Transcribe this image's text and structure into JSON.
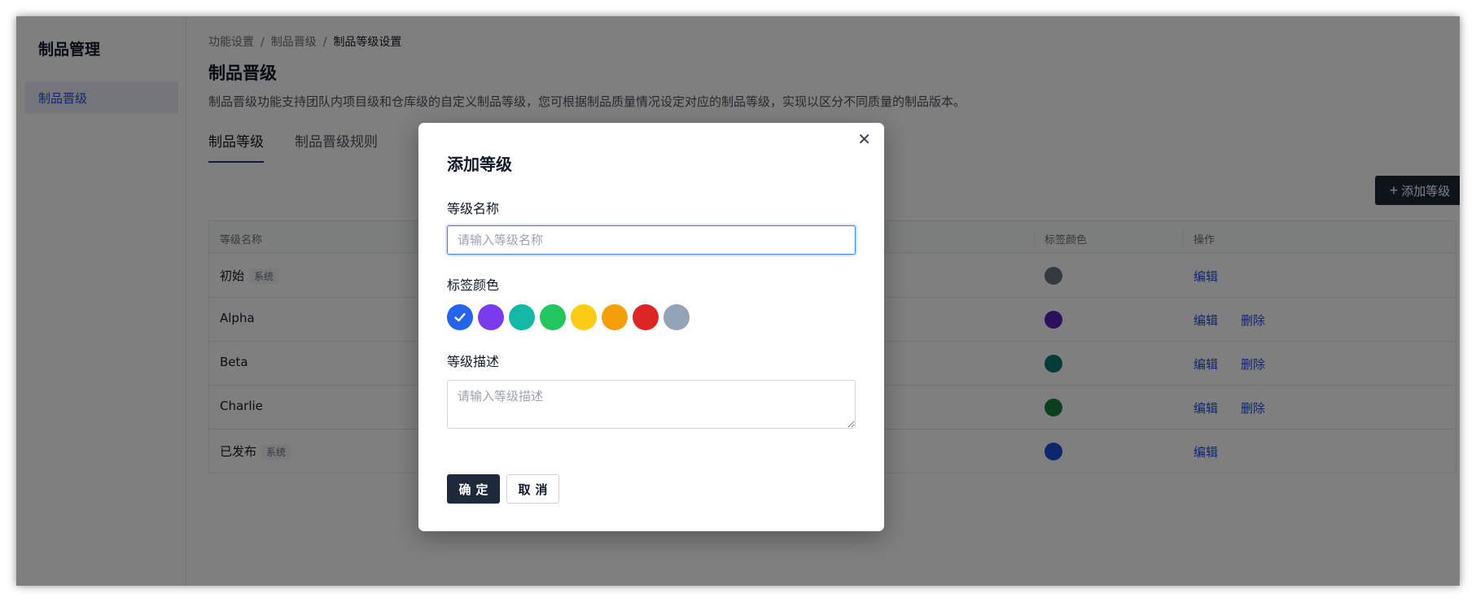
{
  "sidebar": {
    "title": "制品管理",
    "items": [
      {
        "label": "制品晋级"
      }
    ]
  },
  "breadcrumb": [
    "功能设置",
    "制品晋级",
    "制品等级设置"
  ],
  "page": {
    "title": "制品晋级",
    "description": "制品晋级功能支持团队内项目级和仓库级的自定义制品等级，您可根据制品质量情况设定对应的制品等级，实现以区分不同质量的制品版本。"
  },
  "tabs": [
    {
      "label": "制品等级",
      "active": true
    },
    {
      "label": "制品晋级规则",
      "active": false
    }
  ],
  "toolbar": {
    "add_button_label": "添加等级",
    "add_button_icon": "plus-icon"
  },
  "table": {
    "columns": [
      "等级名称",
      "标签颜色",
      "操作"
    ],
    "rows": [
      {
        "name": "初始",
        "badge": "系统",
        "color": "#6b7280",
        "actions": [
          "编辑"
        ]
      },
      {
        "name": "Alpha",
        "badge": "",
        "color": "#5b21b6",
        "actions": [
          "编辑",
          "删除"
        ]
      },
      {
        "name": "Beta",
        "badge": "",
        "color": "#0f766e",
        "actions": [
          "编辑",
          "删除"
        ]
      },
      {
        "name": "Charlie",
        "badge": "",
        "color": "#15803d",
        "actions": [
          "编辑",
          "删除"
        ]
      },
      {
        "name": "已发布",
        "badge": "系统",
        "color": "#1d4ed8",
        "actions": [
          "编辑"
        ]
      }
    ]
  },
  "modal": {
    "title": "添加等级",
    "close_icon": "close-icon",
    "name_label": "等级名称",
    "name_value": "",
    "name_placeholder": "请输入等级名称",
    "color_label": "标签颜色",
    "colors": [
      "#2563eb",
      "#7c3aed",
      "#14b8a6",
      "#22c55e",
      "#facc15",
      "#f59e0b",
      "#dc2626",
      "#94a3b8"
    ],
    "selected_color_index": 0,
    "desc_label": "等级描述",
    "desc_value": "",
    "desc_placeholder": "请输入等级描述",
    "ok_label": "确定",
    "cancel_label": "取消"
  }
}
